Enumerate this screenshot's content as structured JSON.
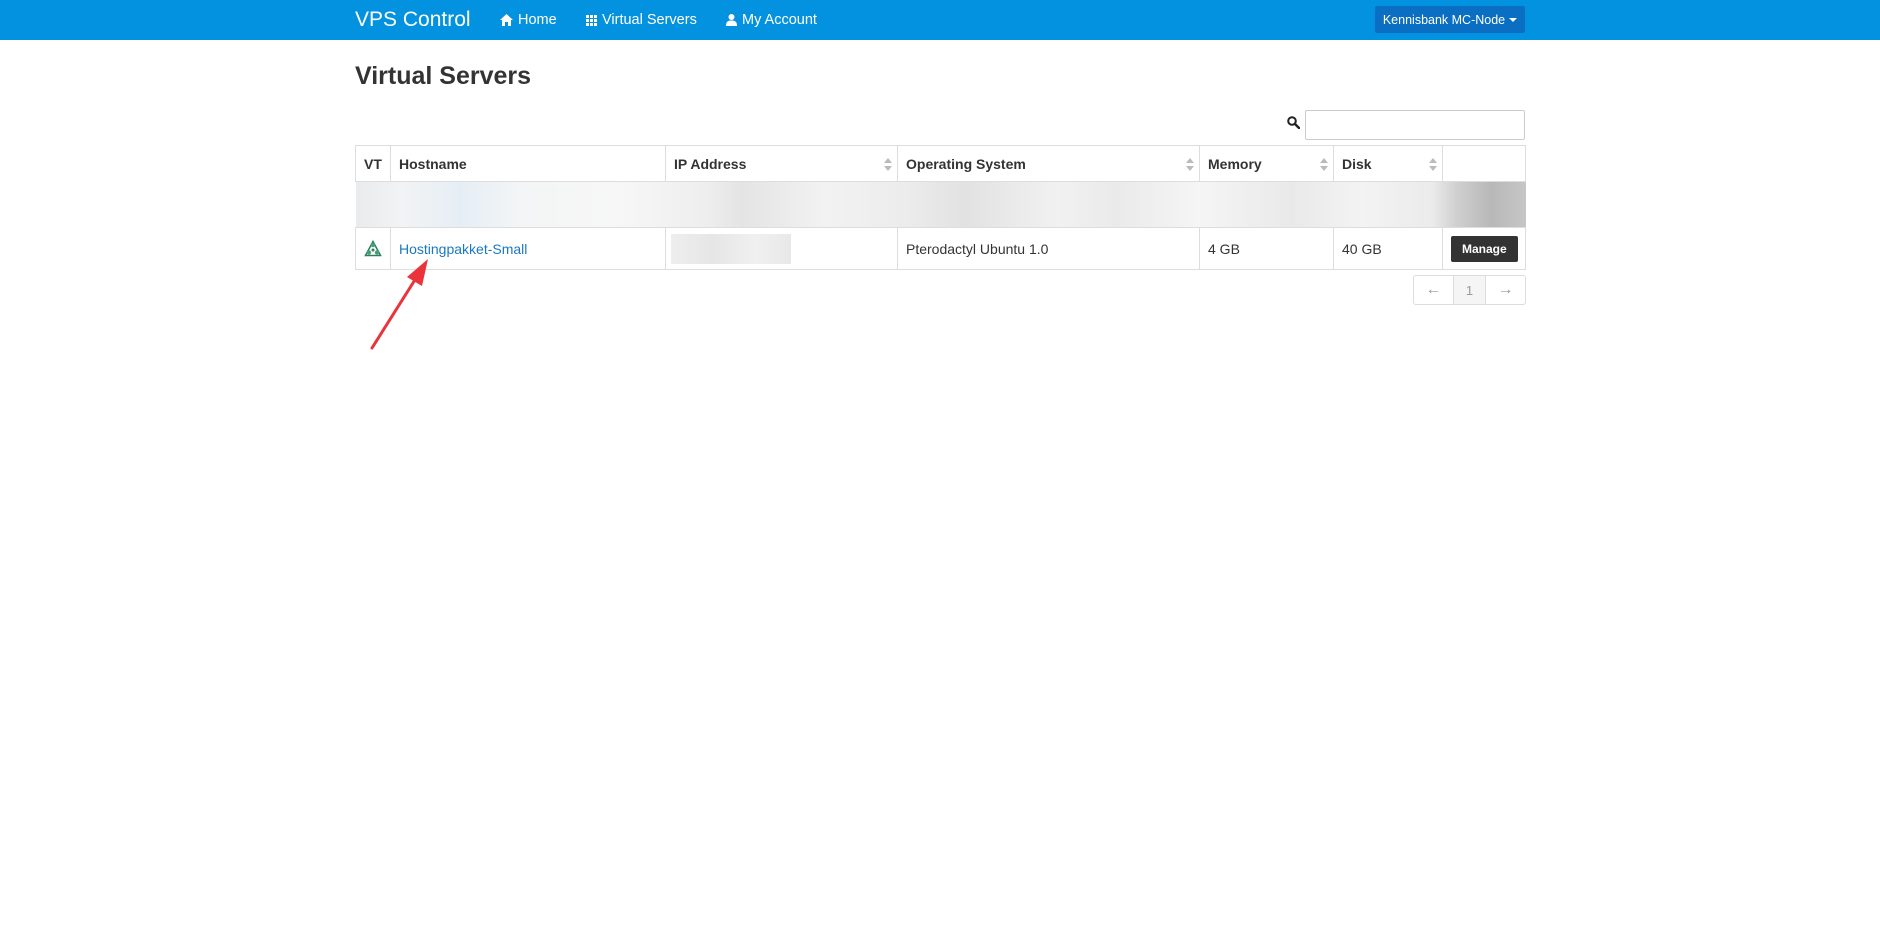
{
  "navbar": {
    "brand": "VPS Control",
    "items": [
      {
        "label": "Home",
        "icon": "home-icon"
      },
      {
        "label": "Virtual Servers",
        "icon": "grid-icon"
      },
      {
        "label": "My Account",
        "icon": "user-icon"
      }
    ],
    "node_dropdown_label": "Kennisbank MC-Node"
  },
  "page": {
    "title": "Virtual Servers",
    "search": {
      "placeholder": "",
      "value": ""
    }
  },
  "table": {
    "columns": [
      "VT",
      "Hostname",
      "IP Address",
      "Operating System",
      "Memory",
      "Disk",
      ""
    ],
    "rows": [
      {
        "vt_icon": "virtualization-icon",
        "hostname": "Hostingpakket-Small",
        "ip_address": "",
        "operating_system": "Pterodactyl Ubuntu 1.0",
        "memory": "4 GB",
        "disk": "40 GB",
        "action_label": "Manage"
      }
    ]
  },
  "pagination": {
    "prev": "←",
    "current_page": "1",
    "next": "→"
  },
  "colors": {
    "navbar": "#0392e0",
    "node_button": "#0a6fc2",
    "link": "#1a78c2",
    "manage_button": "#333333",
    "annotation_arrow": "#e8343a"
  }
}
